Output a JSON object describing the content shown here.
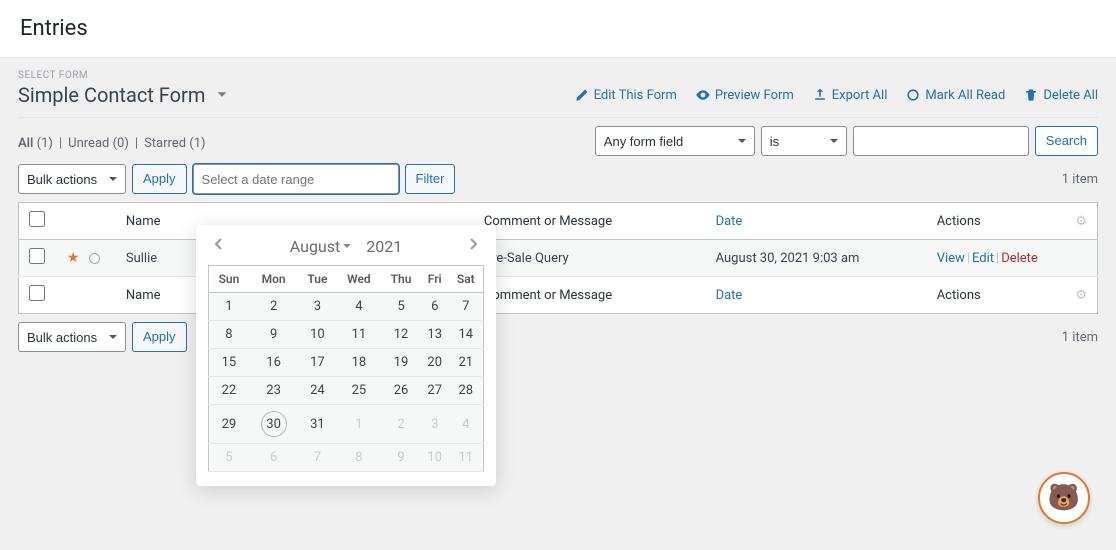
{
  "page_title": "Entries",
  "select_form_label": "SELECT FORM",
  "form_name": "Simple Contact Form",
  "header_actions": {
    "edit": "Edit This Form",
    "preview": "Preview Form",
    "export": "Export All",
    "mark_read": "Mark All Read",
    "delete_all": "Delete All"
  },
  "filters": {
    "all_label": "All",
    "all_count": "(1)",
    "unread_label": "Unread",
    "unread_count": "(0)",
    "starred_label": "Starred",
    "starred_count": "(1)"
  },
  "search": {
    "field_select": "Any form field",
    "op_select": "is",
    "value": "",
    "button": "Search"
  },
  "bulk": {
    "select_label": "Bulk actions",
    "apply": "Apply",
    "date_placeholder": "Select a date range",
    "filter": "Filter"
  },
  "item_count": "1 item",
  "columns": {
    "name": "Name",
    "comment": "Comment or Message",
    "date": "Date",
    "actions": "Actions"
  },
  "rows": [
    {
      "name": "Sullie",
      "comment": "Pre-Sale Query",
      "date": "August 30, 2021 9:03 am",
      "view": "View",
      "edit": "Edit",
      "delete": "Delete"
    }
  ],
  "calendar": {
    "month": "August",
    "year": "2021",
    "dow": [
      "Sun",
      "Mon",
      "Tue",
      "Wed",
      "Thu",
      "Fri",
      "Sat"
    ],
    "weeks": [
      [
        {
          "d": "1"
        },
        {
          "d": "2"
        },
        {
          "d": "3"
        },
        {
          "d": "4"
        },
        {
          "d": "5"
        },
        {
          "d": "6"
        },
        {
          "d": "7"
        }
      ],
      [
        {
          "d": "8"
        },
        {
          "d": "9"
        },
        {
          "d": "10"
        },
        {
          "d": "11"
        },
        {
          "d": "12"
        },
        {
          "d": "13"
        },
        {
          "d": "14"
        }
      ],
      [
        {
          "d": "15"
        },
        {
          "d": "16"
        },
        {
          "d": "17"
        },
        {
          "d": "18"
        },
        {
          "d": "19"
        },
        {
          "d": "20"
        },
        {
          "d": "21"
        }
      ],
      [
        {
          "d": "22"
        },
        {
          "d": "23"
        },
        {
          "d": "24"
        },
        {
          "d": "25"
        },
        {
          "d": "26"
        },
        {
          "d": "27"
        },
        {
          "d": "28"
        }
      ],
      [
        {
          "d": "29"
        },
        {
          "d": "30",
          "today": true
        },
        {
          "d": "31"
        },
        {
          "d": "1",
          "dim": true
        },
        {
          "d": "2",
          "dim": true
        },
        {
          "d": "3",
          "dim": true
        },
        {
          "d": "4",
          "dim": true
        }
      ],
      [
        {
          "d": "5",
          "dim": true
        },
        {
          "d": "6",
          "dim": true
        },
        {
          "d": "7",
          "dim": true
        },
        {
          "d": "8",
          "dim": true
        },
        {
          "d": "9",
          "dim": true
        },
        {
          "d": "10",
          "dim": true
        },
        {
          "d": "11",
          "dim": true
        }
      ]
    ]
  }
}
